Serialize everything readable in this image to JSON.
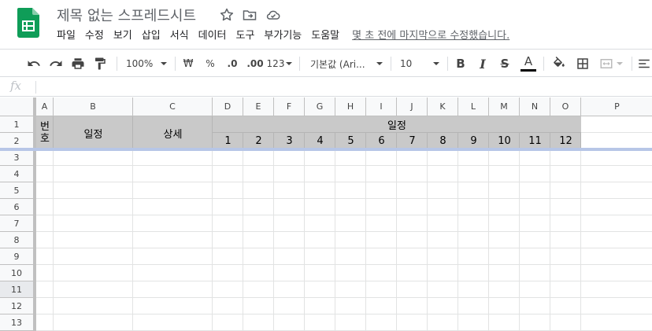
{
  "app": {
    "doc_title": "제목 없는 스프레드시트",
    "menu": [
      "파일",
      "수정",
      "보기",
      "삽입",
      "서식",
      "데이터",
      "도구",
      "부가기능",
      "도움말"
    ],
    "last_edit": "몇 초 전에 마지막으로 수정했습니다."
  },
  "toolbar": {
    "zoom": "100%",
    "currency": "₩",
    "percent": "%",
    "decimal_decrease": ".0",
    "decimal_increase": ".00",
    "number_format": "123",
    "font_family": "기본값 (Ari...",
    "font_size": "10",
    "bold": "B",
    "italic": "I",
    "strike": "S",
    "text_color_letter": "A"
  },
  "formula_bar": {
    "fx_label": "fx",
    "value": ""
  },
  "sheet": {
    "columns": [
      {
        "label": "A"
      },
      {
        "label": "B"
      },
      {
        "label": "C"
      },
      {
        "label": "D"
      },
      {
        "label": "E"
      },
      {
        "label": "F"
      },
      {
        "label": "G"
      },
      {
        "label": "H"
      },
      {
        "label": "I"
      },
      {
        "label": "J"
      },
      {
        "label": "K"
      },
      {
        "label": "L"
      },
      {
        "label": "M"
      },
      {
        "label": "N"
      },
      {
        "label": "O"
      },
      {
        "label": "P"
      }
    ],
    "rows": [
      "1",
      "2",
      "3",
      "4",
      "5",
      "6",
      "7",
      "8",
      "9",
      "10",
      "11",
      "12",
      "13"
    ],
    "selected_row": "11",
    "cells": {
      "a1": "번호",
      "b1": "일정",
      "c1": "상세",
      "d1": "일정",
      "months": [
        "1",
        "2",
        "3",
        "4",
        "5",
        "6",
        "7",
        "8",
        "9",
        "10",
        "11",
        "12"
      ]
    },
    "header_fill_color": "#c9c9c9",
    "freeze_color": "#b7c6e7"
  }
}
